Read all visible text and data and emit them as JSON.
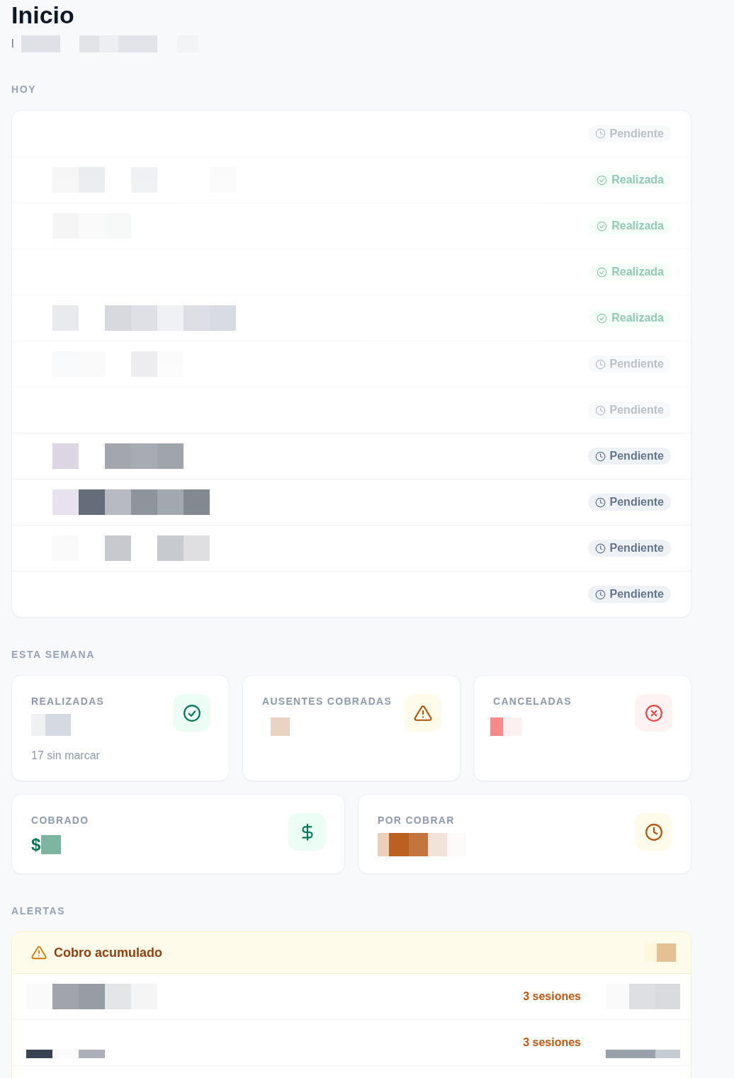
{
  "page": {
    "title": "Inicio",
    "subtitle": "l"
  },
  "today": {
    "heading": "HOY",
    "appointments": [
      {
        "status": "Pendiente",
        "kind": "pending",
        "faded": true,
        "redacted": false
      },
      {
        "status": "Realizada",
        "kind": "done",
        "faded": true,
        "redacted": true
      },
      {
        "status": "Realizada",
        "kind": "done",
        "faded": true,
        "redacted": true
      },
      {
        "status": "Realizada",
        "kind": "done",
        "faded": true,
        "redacted": false
      },
      {
        "status": "Realizada",
        "kind": "done",
        "faded": true,
        "redacted": true
      },
      {
        "status": "Pendiente",
        "kind": "pending",
        "faded": true,
        "redacted": true
      },
      {
        "status": "Pendiente",
        "kind": "pending",
        "faded": true,
        "redacted": false
      },
      {
        "status": "Pendiente",
        "kind": "pending",
        "faded": false,
        "redacted": true
      },
      {
        "status": "Pendiente",
        "kind": "pending",
        "faded": false,
        "redacted": true
      },
      {
        "status": "Pendiente",
        "kind": "pending",
        "faded": false,
        "redacted": true
      },
      {
        "status": "Pendiente",
        "kind": "pending",
        "faded": false,
        "redacted": false
      }
    ]
  },
  "week": {
    "heading": "ESTA SEMANA",
    "stats": [
      {
        "kind": "done",
        "label": "REALIZADAS",
        "note": "17 sin marcar"
      },
      {
        "kind": "no_show",
        "label": "AUSENTES COBRADAS"
      },
      {
        "kind": "cancelled",
        "label": "CANCELADAS"
      }
    ],
    "money": [
      {
        "kind": "collected",
        "label": "COBRADO",
        "prefix": "$"
      },
      {
        "kind": "owed",
        "label": "POR COBRAR"
      }
    ]
  },
  "alerts": {
    "heading": "ALERTAS",
    "groups": [
      {
        "title": "Cobro acumulado",
        "rows": [
          {
            "sessions": "3 sesiones"
          },
          {
            "sessions": "3 sesiones"
          }
        ]
      }
    ]
  }
}
